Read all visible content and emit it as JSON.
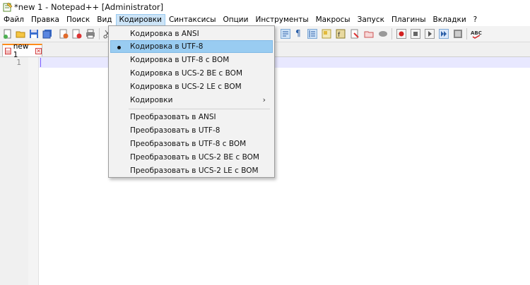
{
  "window": {
    "title": "*new 1 - Notepad++ [Administrator]"
  },
  "menubar": {
    "items": [
      "Файл",
      "Правка",
      "Поиск",
      "Вид",
      "Кодировки",
      "Синтаксисы",
      "Опции",
      "Инструменты",
      "Макросы",
      "Запуск",
      "Плагины",
      "Вкладки",
      "?"
    ],
    "active_index": 4
  },
  "tabs": [
    {
      "label": "new 1",
      "close_glyph": "✕"
    }
  ],
  "editor": {
    "line_numbers": [
      "1"
    ]
  },
  "encoding_menu": {
    "items": [
      {
        "label": "Кодировка в ANSI",
        "checked": false
      },
      {
        "label": "Кодировка в UTF-8",
        "checked": true,
        "highlighted": true
      },
      {
        "label": "Кодировка в UTF-8 с BOM",
        "checked": false
      },
      {
        "label": "Кодировка в UCS-2 BE с BOM",
        "checked": false
      },
      {
        "label": "Кодировка в UCS-2 LE с BOM",
        "checked": false
      },
      {
        "label": "Кодировки",
        "submenu": true,
        "arrow": "›"
      },
      {
        "label": "Преобразовать в ANSI"
      },
      {
        "label": "Преобразовать в UTF-8"
      },
      {
        "label": "Преобразовать в UTF-8 с BOM"
      },
      {
        "label": "Преобразовать в UCS-2 BE с BOM"
      },
      {
        "label": "Преобразовать в UCS-2 LE с BOM"
      }
    ]
  },
  "colors": {
    "menu_highlight": "#99ccf1",
    "active_menu": "#cce4f7",
    "tab_accent": "#ff8c1a",
    "current_line": "#e8e8ff"
  },
  "toolbar_icons": [
    "new-file-icon",
    "open-file-icon",
    "save-icon",
    "save-all-icon",
    "close-icon",
    "close-all-icon",
    "print-icon",
    "cut-icon",
    "wrap-icon",
    "show-all-chars-icon",
    "indent-guide-icon",
    "doc-map-icon",
    "function-list-icon",
    "folder-workspace-icon",
    "monitor-icon",
    "record-macro-icon",
    "stop-macro-icon",
    "play-macro-icon",
    "run-macro-multiple-icon",
    "save-macro-icon",
    "spellcheck-icon"
  ]
}
